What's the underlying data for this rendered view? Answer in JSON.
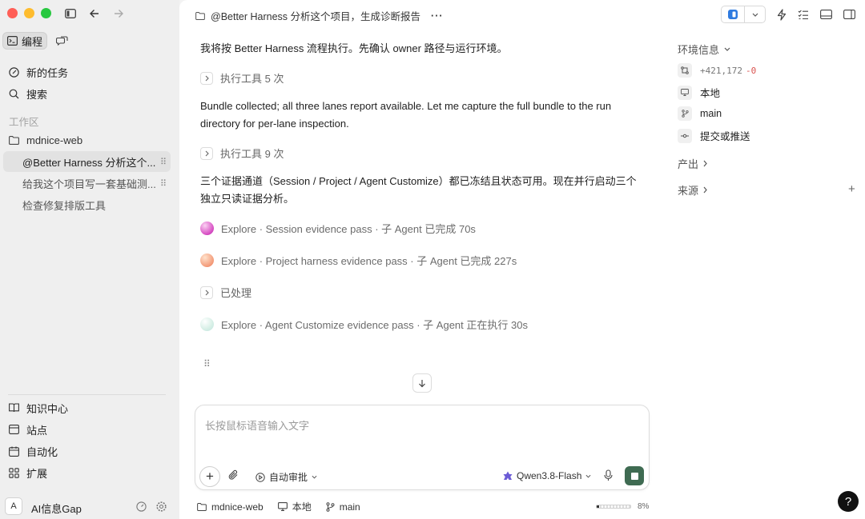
{
  "sidebar": {
    "modes": [
      {
        "label": "编程",
        "active": true,
        "icon": "code-panel-icon"
      },
      {
        "label": "",
        "active": false,
        "icon": "chat-bubbles-icon"
      }
    ],
    "new_task": "新的任务",
    "search": "搜索",
    "workspace_section": "工作区",
    "project": "mdnice-web",
    "threads": [
      {
        "label": "@Better Harness 分析这个...",
        "selected": true
      },
      {
        "label": "给我这个项目写一套基础测...",
        "selected": false
      },
      {
        "label": "检查修复排版工具",
        "selected": false
      }
    ],
    "bottom_items": [
      {
        "label": "知识中心",
        "icon": "book-icon"
      },
      {
        "label": "站点",
        "icon": "site-icon"
      },
      {
        "label": "自动化",
        "icon": "calendar-icon"
      },
      {
        "label": "扩展",
        "icon": "grid-icon"
      }
    ],
    "user": {
      "avatar_letter": "A",
      "name": "AI信息Gap"
    }
  },
  "topbar": {
    "title": "@Better Harness 分析这个项目，生成诊断报告",
    "more": "···"
  },
  "conversation": {
    "msg1": "我将按 Better Harness 流程执行。先确认 owner 路径与运行环境。",
    "tool1": "执行工具 5 次",
    "msg2": "Bundle collected; all three lanes report available. Let me capture the full bundle to the run directory for per-lane inspection.",
    "tool2": "执行工具 9 次",
    "msg3": "三个证据通道（Session / Project / Agent Customize）都已冻结且状态可用。现在并行启动三个独立只读证据分析。",
    "agents": [
      {
        "text": "Explore · Session evidence pass · 子 Agent 已完成 70s"
      },
      {
        "text": "Explore · Project harness evidence pass · 子 Agent 已完成 227s"
      }
    ],
    "processed": "已处理",
    "agent3": "Explore · Agent Customize evidence pass · 子 Agent 正在执行 30s"
  },
  "composer": {
    "placeholder": "长按鼠标语音输入文字",
    "approval": "自动审批",
    "model": "Qwen3.8-Flash"
  },
  "statusbar": {
    "project": "mdnice-web",
    "env": "本地",
    "branch": "main",
    "context_percent": "8%",
    "context_fraction": 0.08
  },
  "right_panel": {
    "env_header": "环境信息",
    "diff_add": "+421,172",
    "diff_del": "-0",
    "location": "本地",
    "branch": "main",
    "commit": "提交或推送",
    "output_header": "产出",
    "source_header": "来源",
    "add_label": "+"
  },
  "help": "?",
  "colors": {
    "accent_green": "#3f6b52",
    "diff_del": "#d9534f",
    "traffic_red": "#ff5f57",
    "traffic_yellow": "#febc2e",
    "traffic_green": "#28c840"
  }
}
